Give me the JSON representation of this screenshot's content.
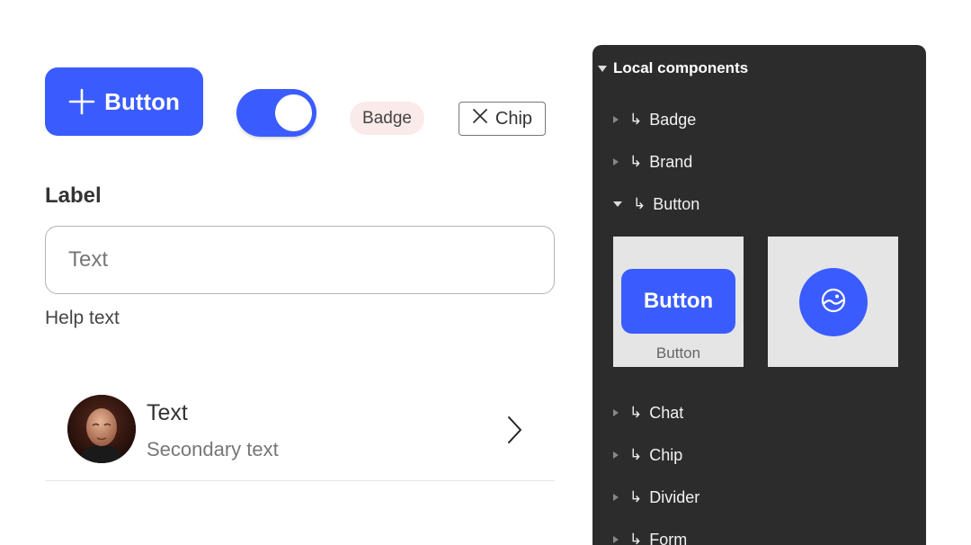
{
  "toolbar": {
    "primary_button_label": "Button",
    "badge_label": "Badge",
    "chip_label": "Chip",
    "toggle_on": true
  },
  "form": {
    "label": "Label",
    "input_placeholder": "Text",
    "input_value": "",
    "help_text": "Help text"
  },
  "list_item": {
    "title": "Text",
    "subtitle": "Secondary text"
  },
  "panel": {
    "header": "Local components",
    "items": [
      {
        "label": "Badge",
        "expanded": false
      },
      {
        "label": "Brand",
        "expanded": false
      },
      {
        "label": "Button",
        "expanded": true
      },
      {
        "label": "Chat",
        "expanded": false
      },
      {
        "label": "Chip",
        "expanded": false
      },
      {
        "label": "Divider",
        "expanded": false
      },
      {
        "label": "Form",
        "expanded": false
      }
    ],
    "thumbnails": {
      "button_preview_label": "Button",
      "button_caption": "Button"
    }
  },
  "colors": {
    "brand": "#3a5cff",
    "panel_bg": "#2c2c2c",
    "badge_bg": "#fbeaea"
  }
}
